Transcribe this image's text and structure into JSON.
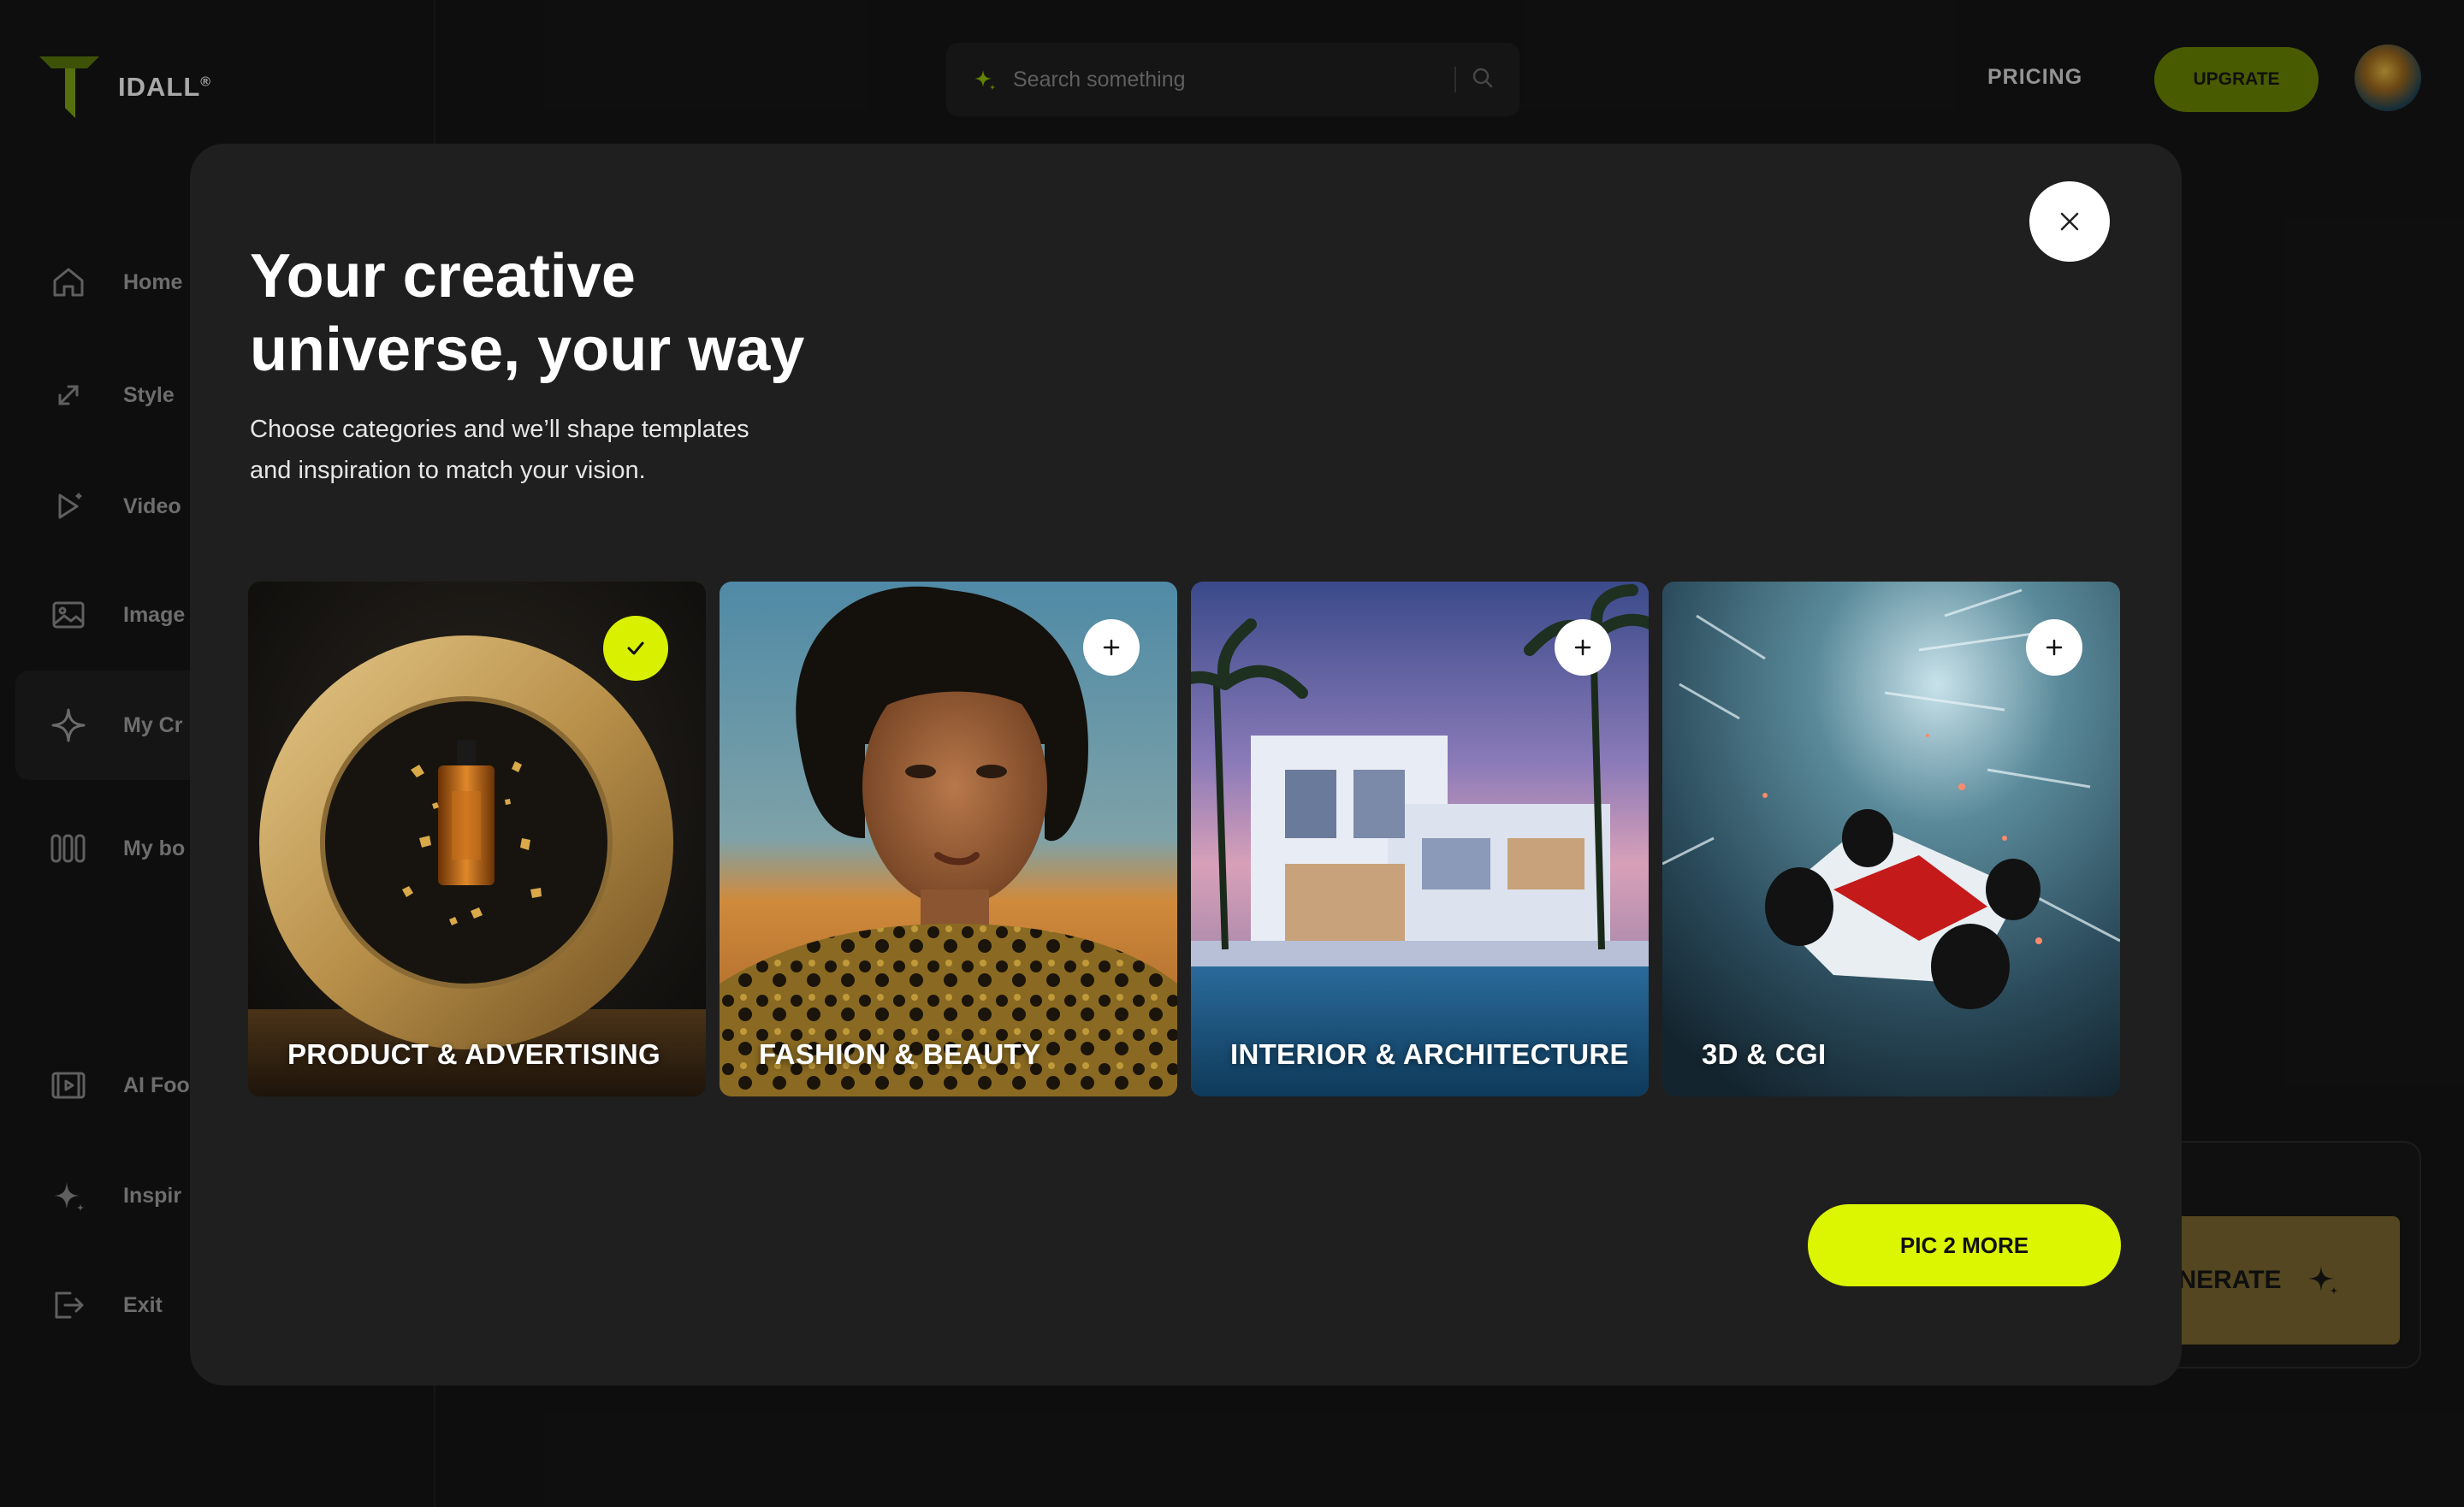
{
  "app": {
    "brand": "IDALL",
    "brand_mark": "®",
    "accent_color": "#dcf500"
  },
  "sidebar": {
    "items": [
      {
        "label": "Home",
        "icon": "home-icon"
      },
      {
        "label": "Style",
        "icon": "expand-arrows-icon"
      },
      {
        "label": "Video",
        "icon": "play-icon"
      },
      {
        "label": "Image",
        "icon": "image-icon"
      },
      {
        "label": "My Cr",
        "icon": "sparkle-icon",
        "active": true
      },
      {
        "label": "My bo",
        "icon": "boards-icon"
      },
      {
        "label": "AI Foo",
        "icon": "film-icon"
      },
      {
        "label": "Inspir",
        "icon": "sparkle-small-icon"
      },
      {
        "label": "Exit",
        "icon": "exit-icon"
      }
    ]
  },
  "topbar": {
    "search_placeholder": "Search something",
    "pricing_label": "PRICING",
    "upgrade_label": "UPGRATE"
  },
  "background": {
    "generate_label": "ENERATE"
  },
  "modal": {
    "title_line1": "Your creative",
    "title_line2": "universe, your way",
    "subtitle_line1": "Choose categories and we’ll shape templates",
    "subtitle_line2": "and inspiration to match your vision.",
    "categories": [
      {
        "label": "PRODUCT & ADVERTISING",
        "selected": true,
        "toggle_icon": "check-icon"
      },
      {
        "label": "FASHION & BEAUTY",
        "selected": false,
        "toggle_icon": "plus-icon"
      },
      {
        "label": "INTERIOR & ARCHITECTURE",
        "selected": false,
        "toggle_icon": "plus-icon"
      },
      {
        "label": "3D & CGI",
        "selected": false,
        "toggle_icon": "plus-icon"
      }
    ],
    "primary_button": "PIC 2 MORE"
  }
}
